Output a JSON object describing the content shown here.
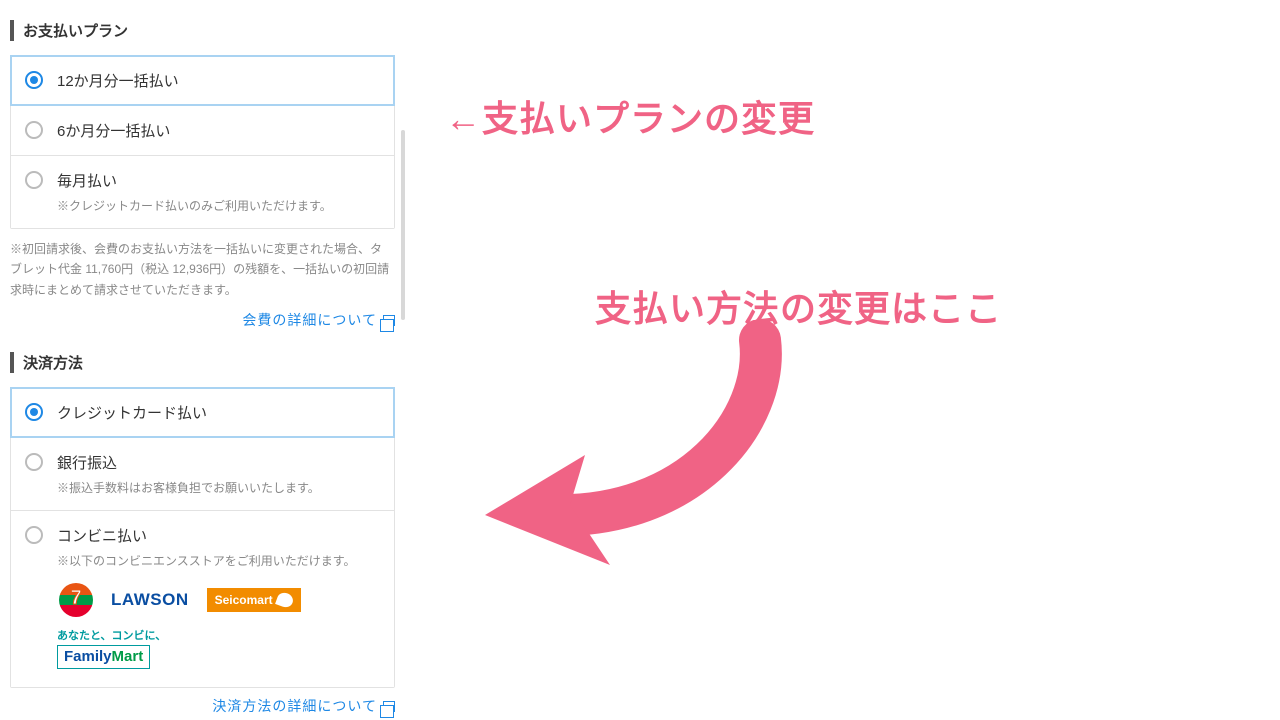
{
  "colors": {
    "accent": "#1e88e5",
    "annotation": "#f06385"
  },
  "payment_plan": {
    "heading": "お支払いプラン",
    "options": [
      {
        "label": "12か月分一括払い",
        "note": "",
        "selected": true
      },
      {
        "label": "6か月分一括払い",
        "note": "",
        "selected": false
      },
      {
        "label": "毎月払い",
        "note": "※クレジットカード払いのみご利用いただけます。",
        "selected": false
      }
    ],
    "footnote": "※初回請求後、会費のお支払い方法を一括払いに変更された場合、タブレット代金 11,760円（税込 12,936円）の残額を、一括払いの初回請求時にまとめて請求させていただきます。",
    "detail_link": "会費の詳細について"
  },
  "payment_method": {
    "heading": "決済方法",
    "options": [
      {
        "label": "クレジットカード払い",
        "note": "",
        "selected": true
      },
      {
        "label": "銀行振込",
        "note": "※振込手数料はお客様負担でお願いいたします。",
        "selected": false
      },
      {
        "label": "コンビニ払い",
        "note": "※以下のコンビニエンスストアをご利用いただけます。",
        "selected": false,
        "stores": [
          "seven-eleven",
          "lawson",
          "seicomart",
          "familymart"
        ]
      }
    ],
    "store_labels": {
      "lawson": "LAWSON",
      "seicomart": "Seicomart",
      "familymart_tag": "あなたと、コンビに、",
      "familymart": "FamilyMart"
    },
    "detail_link": "決済方法の詳細について"
  },
  "annotations": {
    "plan_change": "←支払いプランの変更",
    "method_change": "支払い方法の変更はここ"
  }
}
